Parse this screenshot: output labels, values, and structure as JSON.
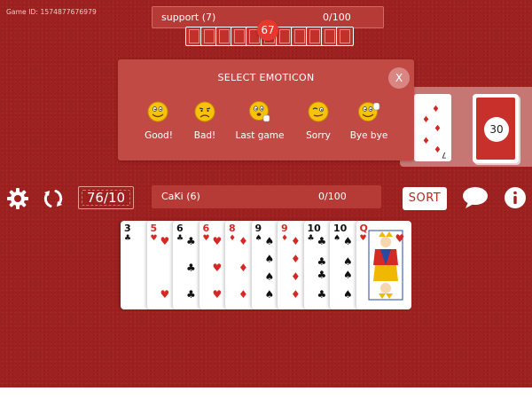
{
  "game_id": "Game ID: 1574877676979",
  "opponent": {
    "name": "support (7)",
    "score": "0/100",
    "card_count": "67"
  },
  "emoticon_panel": {
    "title": "SELECT EMOTICON",
    "close_label": "X",
    "items": [
      {
        "label": "Good!",
        "icon": "thumbs-up-smiley-icon"
      },
      {
        "label": "Bad!",
        "icon": "frown-smiley-icon"
      },
      {
        "label": "Last game",
        "icon": "pointing-smiley-icon"
      },
      {
        "label": "Sorry",
        "icon": "wink-smiley-icon"
      },
      {
        "label": "Bye bye",
        "icon": "waving-smiley-icon"
      }
    ]
  },
  "discard": {
    "rank": "7",
    "suit": "♦"
  },
  "draw_pile": {
    "count": "30"
  },
  "toolbar": {
    "settings_icon": "gear-icon",
    "refresh_icon": "refresh-icon",
    "round_score": "76/10",
    "sort_label": "SORT",
    "chat_icon": "chat-bubble-icon",
    "info_icon": "info-icon"
  },
  "player": {
    "name": "CaKi (6)",
    "score": "0/100"
  },
  "hand": [
    {
      "rank": "3",
      "suit": "♣",
      "color": "black"
    },
    {
      "rank": "5",
      "suit": "♥",
      "color": "red"
    },
    {
      "rank": "6",
      "suit": "♣",
      "color": "black"
    },
    {
      "rank": "6",
      "suit": "♥",
      "color": "red"
    },
    {
      "rank": "8",
      "suit": "♦",
      "color": "red"
    },
    {
      "rank": "9",
      "suit": "♠",
      "color": "black"
    },
    {
      "rank": "9",
      "suit": "♦",
      "color": "red"
    },
    {
      "rank": "10",
      "suit": "♣",
      "color": "black"
    },
    {
      "rank": "10",
      "suit": "♠",
      "color": "black"
    },
    {
      "rank": "Q",
      "suit": "♥",
      "color": "red"
    }
  ],
  "colors": {
    "felt": "#9e211f",
    "bar": "#b63b36",
    "red_suit": "#d32a25",
    "smiley": "#f7c20b"
  }
}
